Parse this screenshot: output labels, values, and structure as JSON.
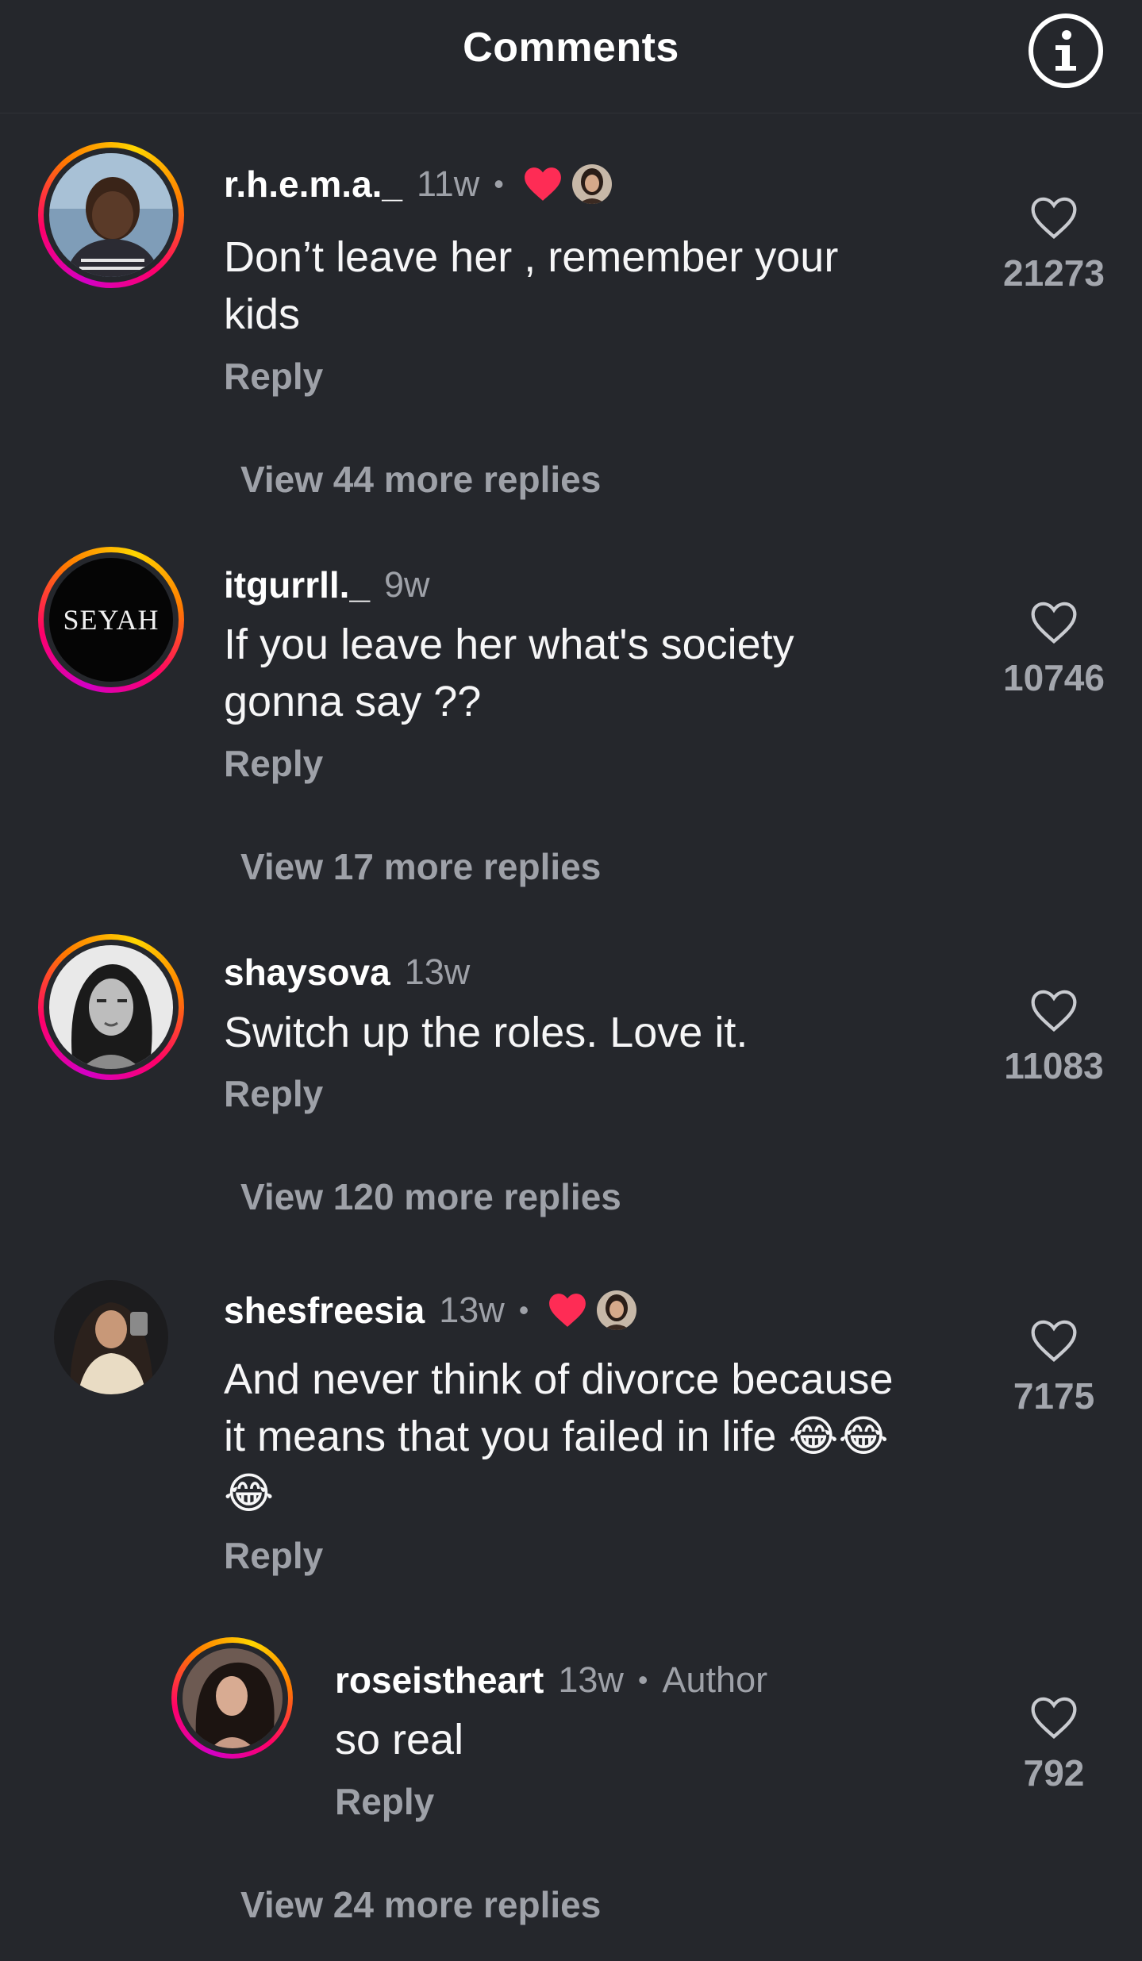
{
  "header": {
    "title": "Comments"
  },
  "icons": {
    "info": "info-icon",
    "like": "heart-outline-icon",
    "liked_by_creator": "heart-filled-icon"
  },
  "colors": {
    "background": "#25272c",
    "liked_heart": "#fe2c55",
    "secondary_text": "#9ea1a8",
    "story_ring": [
      "#d300c5",
      "#ff0069",
      "#ff7a00",
      "#ffd600"
    ]
  },
  "comments": [
    {
      "username": "r.h.e.m.a._",
      "time": "11w",
      "text": "Don’t leave her , remember your kids",
      "reply_label": "Reply",
      "likes": "21273",
      "liked_by_creator": true,
      "view_more": "View 44 more replies"
    },
    {
      "username": "itgurrll._",
      "time": "9w",
      "avatar_text": "SEYAH",
      "text": "If you leave her what's society gonna say ??",
      "reply_label": "Reply",
      "likes": "10746",
      "view_more": "View 17 more replies"
    },
    {
      "username": "shaysova",
      "time": "13w",
      "text": "Switch up the roles. Love it.",
      "reply_label": "Reply",
      "likes": "11083",
      "view_more": "View 120 more replies"
    },
    {
      "username": "shesfreesia",
      "time": "13w",
      "text": "And never think of divorce because it means that you failed in life 😂😂😂",
      "reply_label": "Reply",
      "likes": "7175",
      "liked_by_creator": true,
      "replies": [
        {
          "username": "roseistheart",
          "time": "13w",
          "badge": "Author",
          "text": "so real",
          "reply_label": "Reply",
          "likes": "792"
        }
      ],
      "view_more": "View 24 more replies"
    }
  ]
}
